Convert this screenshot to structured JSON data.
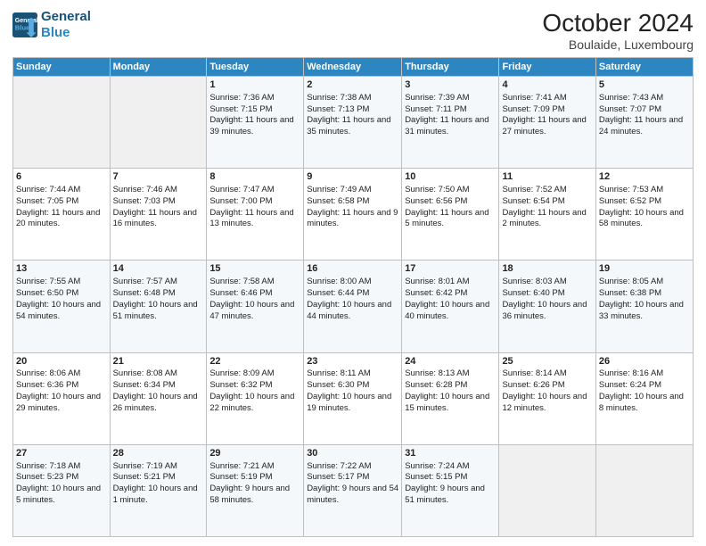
{
  "header": {
    "logo_line1": "General",
    "logo_line2": "Blue",
    "month": "October 2024",
    "location": "Boulaide, Luxembourg"
  },
  "weekdays": [
    "Sunday",
    "Monday",
    "Tuesday",
    "Wednesday",
    "Thursday",
    "Friday",
    "Saturday"
  ],
  "weeks": [
    [
      {
        "day": "",
        "info": ""
      },
      {
        "day": "",
        "info": ""
      },
      {
        "day": "1",
        "info": "Sunrise: 7:36 AM\nSunset: 7:15 PM\nDaylight: 11 hours and 39 minutes."
      },
      {
        "day": "2",
        "info": "Sunrise: 7:38 AM\nSunset: 7:13 PM\nDaylight: 11 hours and 35 minutes."
      },
      {
        "day": "3",
        "info": "Sunrise: 7:39 AM\nSunset: 7:11 PM\nDaylight: 11 hours and 31 minutes."
      },
      {
        "day": "4",
        "info": "Sunrise: 7:41 AM\nSunset: 7:09 PM\nDaylight: 11 hours and 27 minutes."
      },
      {
        "day": "5",
        "info": "Sunrise: 7:43 AM\nSunset: 7:07 PM\nDaylight: 11 hours and 24 minutes."
      }
    ],
    [
      {
        "day": "6",
        "info": "Sunrise: 7:44 AM\nSunset: 7:05 PM\nDaylight: 11 hours and 20 minutes."
      },
      {
        "day": "7",
        "info": "Sunrise: 7:46 AM\nSunset: 7:03 PM\nDaylight: 11 hours and 16 minutes."
      },
      {
        "day": "8",
        "info": "Sunrise: 7:47 AM\nSunset: 7:00 PM\nDaylight: 11 hours and 13 minutes."
      },
      {
        "day": "9",
        "info": "Sunrise: 7:49 AM\nSunset: 6:58 PM\nDaylight: 11 hours and 9 minutes."
      },
      {
        "day": "10",
        "info": "Sunrise: 7:50 AM\nSunset: 6:56 PM\nDaylight: 11 hours and 5 minutes."
      },
      {
        "day": "11",
        "info": "Sunrise: 7:52 AM\nSunset: 6:54 PM\nDaylight: 11 hours and 2 minutes."
      },
      {
        "day": "12",
        "info": "Sunrise: 7:53 AM\nSunset: 6:52 PM\nDaylight: 10 hours and 58 minutes."
      }
    ],
    [
      {
        "day": "13",
        "info": "Sunrise: 7:55 AM\nSunset: 6:50 PM\nDaylight: 10 hours and 54 minutes."
      },
      {
        "day": "14",
        "info": "Sunrise: 7:57 AM\nSunset: 6:48 PM\nDaylight: 10 hours and 51 minutes."
      },
      {
        "day": "15",
        "info": "Sunrise: 7:58 AM\nSunset: 6:46 PM\nDaylight: 10 hours and 47 minutes."
      },
      {
        "day": "16",
        "info": "Sunrise: 8:00 AM\nSunset: 6:44 PM\nDaylight: 10 hours and 44 minutes."
      },
      {
        "day": "17",
        "info": "Sunrise: 8:01 AM\nSunset: 6:42 PM\nDaylight: 10 hours and 40 minutes."
      },
      {
        "day": "18",
        "info": "Sunrise: 8:03 AM\nSunset: 6:40 PM\nDaylight: 10 hours and 36 minutes."
      },
      {
        "day": "19",
        "info": "Sunrise: 8:05 AM\nSunset: 6:38 PM\nDaylight: 10 hours and 33 minutes."
      }
    ],
    [
      {
        "day": "20",
        "info": "Sunrise: 8:06 AM\nSunset: 6:36 PM\nDaylight: 10 hours and 29 minutes."
      },
      {
        "day": "21",
        "info": "Sunrise: 8:08 AM\nSunset: 6:34 PM\nDaylight: 10 hours and 26 minutes."
      },
      {
        "day": "22",
        "info": "Sunrise: 8:09 AM\nSunset: 6:32 PM\nDaylight: 10 hours and 22 minutes."
      },
      {
        "day": "23",
        "info": "Sunrise: 8:11 AM\nSunset: 6:30 PM\nDaylight: 10 hours and 19 minutes."
      },
      {
        "day": "24",
        "info": "Sunrise: 8:13 AM\nSunset: 6:28 PM\nDaylight: 10 hours and 15 minutes."
      },
      {
        "day": "25",
        "info": "Sunrise: 8:14 AM\nSunset: 6:26 PM\nDaylight: 10 hours and 12 minutes."
      },
      {
        "day": "26",
        "info": "Sunrise: 8:16 AM\nSunset: 6:24 PM\nDaylight: 10 hours and 8 minutes."
      }
    ],
    [
      {
        "day": "27",
        "info": "Sunrise: 7:18 AM\nSunset: 5:23 PM\nDaylight: 10 hours and 5 minutes."
      },
      {
        "day": "28",
        "info": "Sunrise: 7:19 AM\nSunset: 5:21 PM\nDaylight: 10 hours and 1 minute."
      },
      {
        "day": "29",
        "info": "Sunrise: 7:21 AM\nSunset: 5:19 PM\nDaylight: 9 hours and 58 minutes."
      },
      {
        "day": "30",
        "info": "Sunrise: 7:22 AM\nSunset: 5:17 PM\nDaylight: 9 hours and 54 minutes."
      },
      {
        "day": "31",
        "info": "Sunrise: 7:24 AM\nSunset: 5:15 PM\nDaylight: 9 hours and 51 minutes."
      },
      {
        "day": "",
        "info": ""
      },
      {
        "day": "",
        "info": ""
      }
    ]
  ]
}
